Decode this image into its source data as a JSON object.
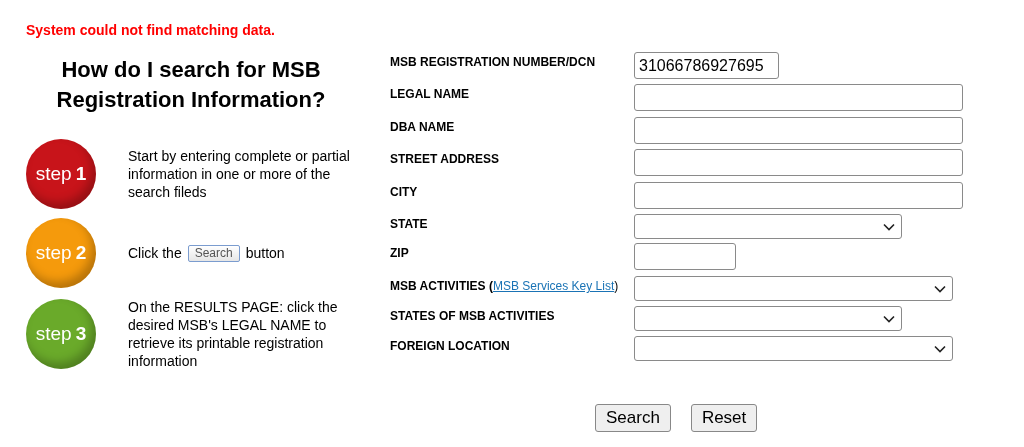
{
  "error_message": "System could not find matching data.",
  "heading": "How do I search for MSB Registration Information?",
  "steps": [
    {
      "word": "step",
      "number": "1",
      "color": "#c8141a",
      "text": "Start by entering complete or partial information in one or more of the search fileds"
    },
    {
      "word": "step",
      "number": "2",
      "color": "#f59a0c",
      "text_before": "Click the",
      "button": "Search",
      "text_after": "button"
    },
    {
      "word": "step",
      "number": "3",
      "color": "#6aaa2a",
      "text": "On the RESULTS PAGE: click the desired MSB's LEGAL NAME to retrieve its printable registration information"
    }
  ],
  "fields": [
    {
      "kind": "text",
      "label": "MSB REGISTRATION NUMBER/DCN",
      "value": "31066786927695"
    },
    {
      "kind": "text",
      "label": "LEGAL NAME"
    },
    {
      "kind": "text",
      "label": "DBA NAME"
    },
    {
      "kind": "text",
      "label": "STREET ADDRESS"
    },
    {
      "kind": "text",
      "label": "CITY"
    },
    {
      "kind": "select",
      "label": "STATE"
    },
    {
      "kind": "text",
      "label": "ZIP"
    },
    {
      "kind": "select",
      "label": "MSB ACTIVITIES (",
      "link": "MSB Services Key List",
      "label_after": ")"
    },
    {
      "kind": "select",
      "label": "STATES OF MSB ACTIVITIES"
    },
    {
      "kind": "select",
      "label": "FOREIGN LOCATION"
    }
  ],
  "buttons": [
    "Search",
    "Reset"
  ]
}
